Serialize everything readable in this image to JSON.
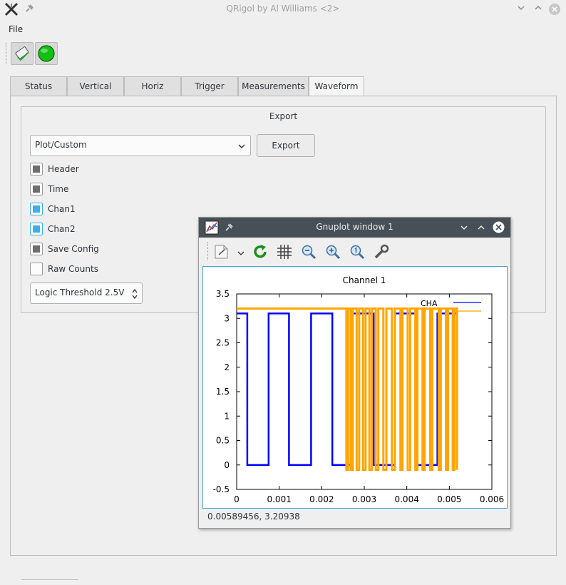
{
  "window": {
    "title": "QRigol by Al Williams <2>"
  },
  "menu": {
    "file": "File"
  },
  "tabs": [
    {
      "label": "Status"
    },
    {
      "label": "Vertical"
    },
    {
      "label": "Horiz"
    },
    {
      "label": "Trigger"
    },
    {
      "label": "Measurements"
    },
    {
      "label": "Waveform",
      "active": true
    }
  ],
  "export_group": {
    "title": "Export",
    "format_value": "Plot/Custom",
    "export_button": "Export",
    "checkboxes": [
      {
        "label": "Header",
        "state": "partial"
      },
      {
        "label": "Time",
        "state": "partial"
      },
      {
        "label": "Chan1",
        "state": "checked"
      },
      {
        "label": "Chan2",
        "state": "checked"
      },
      {
        "label": "Save Config",
        "state": "partial"
      },
      {
        "label": "Raw Counts",
        "state": "unchecked"
      }
    ],
    "threshold_value": "Logic Threshold 2.5V"
  },
  "gnuplot": {
    "title": "Gnuplot window 1",
    "status_coords": "0.00589456,  3.20938"
  },
  "chart_data": {
    "type": "line",
    "title": "Channel 1",
    "xlim": [
      0,
      0.006
    ],
    "ylim": [
      -0.5,
      3.5
    ],
    "x_ticks": [
      "0",
      "0.001",
      "0.002",
      "0.003",
      "0.004",
      "0.005",
      "0.006"
    ],
    "y_ticks": [
      "-0.5",
      "0",
      "0.5",
      "1",
      "1.5",
      "2",
      "2.5",
      "3",
      "3.5"
    ],
    "legend_position": "top-right",
    "series": [
      {
        "name": "CHA",
        "color": "#0000ff",
        "high": 3.1,
        "low": 0.0,
        "transitions": [
          0.0,
          0.00025,
          0.00075,
          0.00123,
          0.00175,
          0.00225,
          0.00272,
          0.00322,
          0.00372,
          0.00422,
          0.00472,
          0.00518
        ]
      },
      {
        "name": "",
        "color": "#ffa500",
        "high": 3.2,
        "low": -0.1,
        "start_high": true,
        "transitions": [
          0.0,
          0.00258,
          0.00262,
          0.00268,
          0.00273,
          0.00282,
          0.00288,
          0.00297,
          0.00303,
          0.00312,
          0.00318,
          0.00327,
          0.00333,
          0.00345,
          0.00352,
          0.00365,
          0.00372,
          0.00385,
          0.0039,
          0.00402,
          0.00408,
          0.0042,
          0.00425,
          0.00437,
          0.00442,
          0.00455,
          0.0046,
          0.00475,
          0.0048,
          0.00492,
          0.00497,
          0.00508,
          0.00512,
          0.00518
        ]
      }
    ]
  },
  "colors": {
    "accent": "#3daee9",
    "gnuplot_titlebar": "#475057"
  }
}
